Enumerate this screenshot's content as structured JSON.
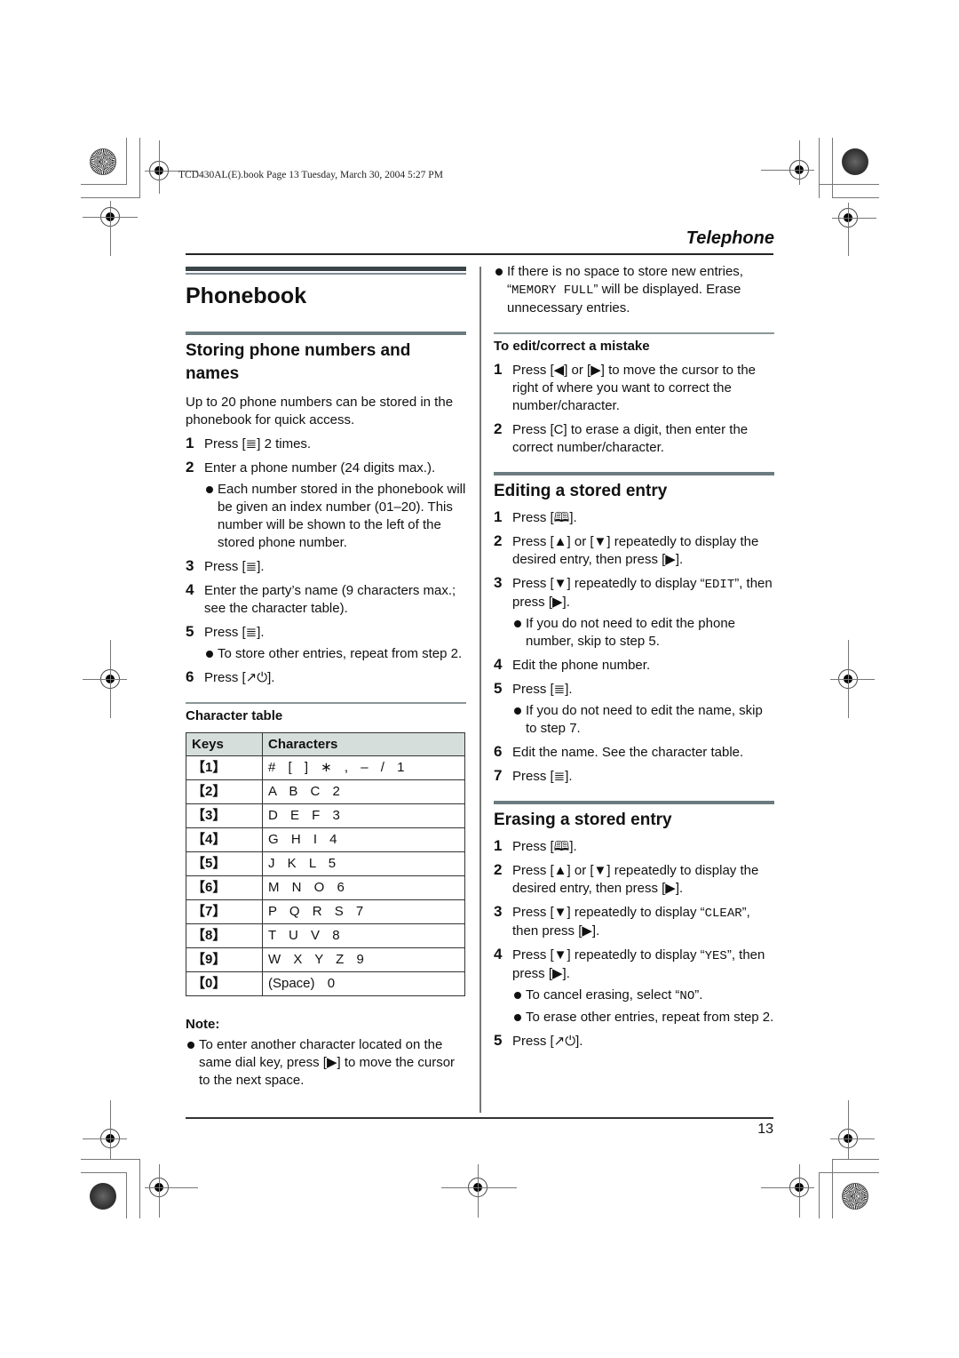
{
  "header_info": "TCD430AL(E).book  Page 13  Tuesday, March 30, 2004  5:27 PM",
  "section_tag": "Telephone",
  "page_number": "13",
  "left": {
    "title": "Phonebook",
    "storing": {
      "heading": "Storing phone numbers and names",
      "intro": "Up to 20 phone numbers can be stored in the phonebook for quick access.",
      "steps": [
        {
          "num": "1",
          "text": "Press [≣] 2 times."
        },
        {
          "num": "2",
          "text": "Enter a phone number (24 digits max.).",
          "bullet": "Each number stored in the phonebook will be given an index number (01–20). This number will be shown to the left of the stored phone number."
        },
        {
          "num": "3",
          "text": "Press [≣]."
        },
        {
          "num": "4",
          "text": "Enter the party’s name (9 characters max.; see the character table)."
        },
        {
          "num": "5",
          "text": "Press [≣].",
          "bullet": "To store other entries, repeat from step 2."
        },
        {
          "num": "6",
          "text": "Press [↗⏻]."
        }
      ]
    },
    "character_table": {
      "heading": "Character table",
      "columns": [
        "Keys",
        "Characters"
      ],
      "rows": [
        {
          "key": "【1】",
          "chars": "#  [  ]  ∗ ,  –  /  1"
        },
        {
          "key": "【2】",
          "chars": "A B C 2"
        },
        {
          "key": "【3】",
          "chars": "D E F 3"
        },
        {
          "key": "【4】",
          "chars": "G H I 4"
        },
        {
          "key": "【5】",
          "chars": "J K L 5"
        },
        {
          "key": "【6】",
          "chars": "M N O 6"
        },
        {
          "key": "【7】",
          "chars": "P Q R S 7"
        },
        {
          "key": "【8】",
          "chars": "T U V 8"
        },
        {
          "key": "【9】",
          "chars": "W X Y Z 9"
        },
        {
          "key": "【0】",
          "chars": "(Space) 0"
        }
      ]
    },
    "note": {
      "label": "Note:",
      "bullet": "To enter another character located on the same dial key, press [▶] to move the cursor to the next space."
    }
  },
  "right": {
    "memory_full_bullet_pre": "If there is no space to store new entries, “",
    "memory_full_code": "MEMORY FULL",
    "memory_full_bullet_post": "” will be displayed. Erase unnecessary entries.",
    "edit_mistake": {
      "heading": "To edit/correct a mistake",
      "steps": [
        {
          "num": "1",
          "text": "Press [◀] or [▶] to move the cursor to the right of where you want to correct the number/character."
        },
        {
          "num": "2",
          "text": "Press [C] to erase a digit, then enter the correct number/character."
        }
      ]
    },
    "editing": {
      "heading": "Editing a stored entry",
      "steps": [
        {
          "num": "1",
          "text": "Press [🕮]."
        },
        {
          "num": "2",
          "text": "Press [▲] or [▼] repeatedly to display the desired entry, then press [▶]."
        },
        {
          "num": "3",
          "pre": "Press [▼] repeatedly to display “",
          "code": "EDIT",
          "post": "”, then press [▶].",
          "bullet": "If you do not need to edit the phone number, skip to step 5."
        },
        {
          "num": "4",
          "text": "Edit the phone number."
        },
        {
          "num": "5",
          "text": "Press [≣].",
          "bullet": "If you do not need to edit the name, skip to step 7."
        },
        {
          "num": "6",
          "text": "Edit the name. See the character table."
        },
        {
          "num": "7",
          "text": "Press [≣]."
        }
      ]
    },
    "erasing": {
      "heading": "Erasing a stored entry",
      "steps": [
        {
          "num": "1",
          "text": "Press [🕮]."
        },
        {
          "num": "2",
          "text": "Press [▲] or [▼] repeatedly to display the desired entry, then press [▶]."
        },
        {
          "num": "3",
          "pre": "Press [▼] repeatedly to display “",
          "code": "CLEAR",
          "post": "”, then press [▶]."
        },
        {
          "num": "4",
          "pre": "Press [▼] repeatedly to display “",
          "code": "YES",
          "post": "”, then press [▶].",
          "bullet1_pre": "To cancel erasing, select “",
          "bullet1_code": "NO",
          "bullet1_post": "”.",
          "bullet2": "To erase other entries, repeat from step 2."
        },
        {
          "num": "5",
          "text": "Press [↗⏻]."
        }
      ]
    }
  }
}
